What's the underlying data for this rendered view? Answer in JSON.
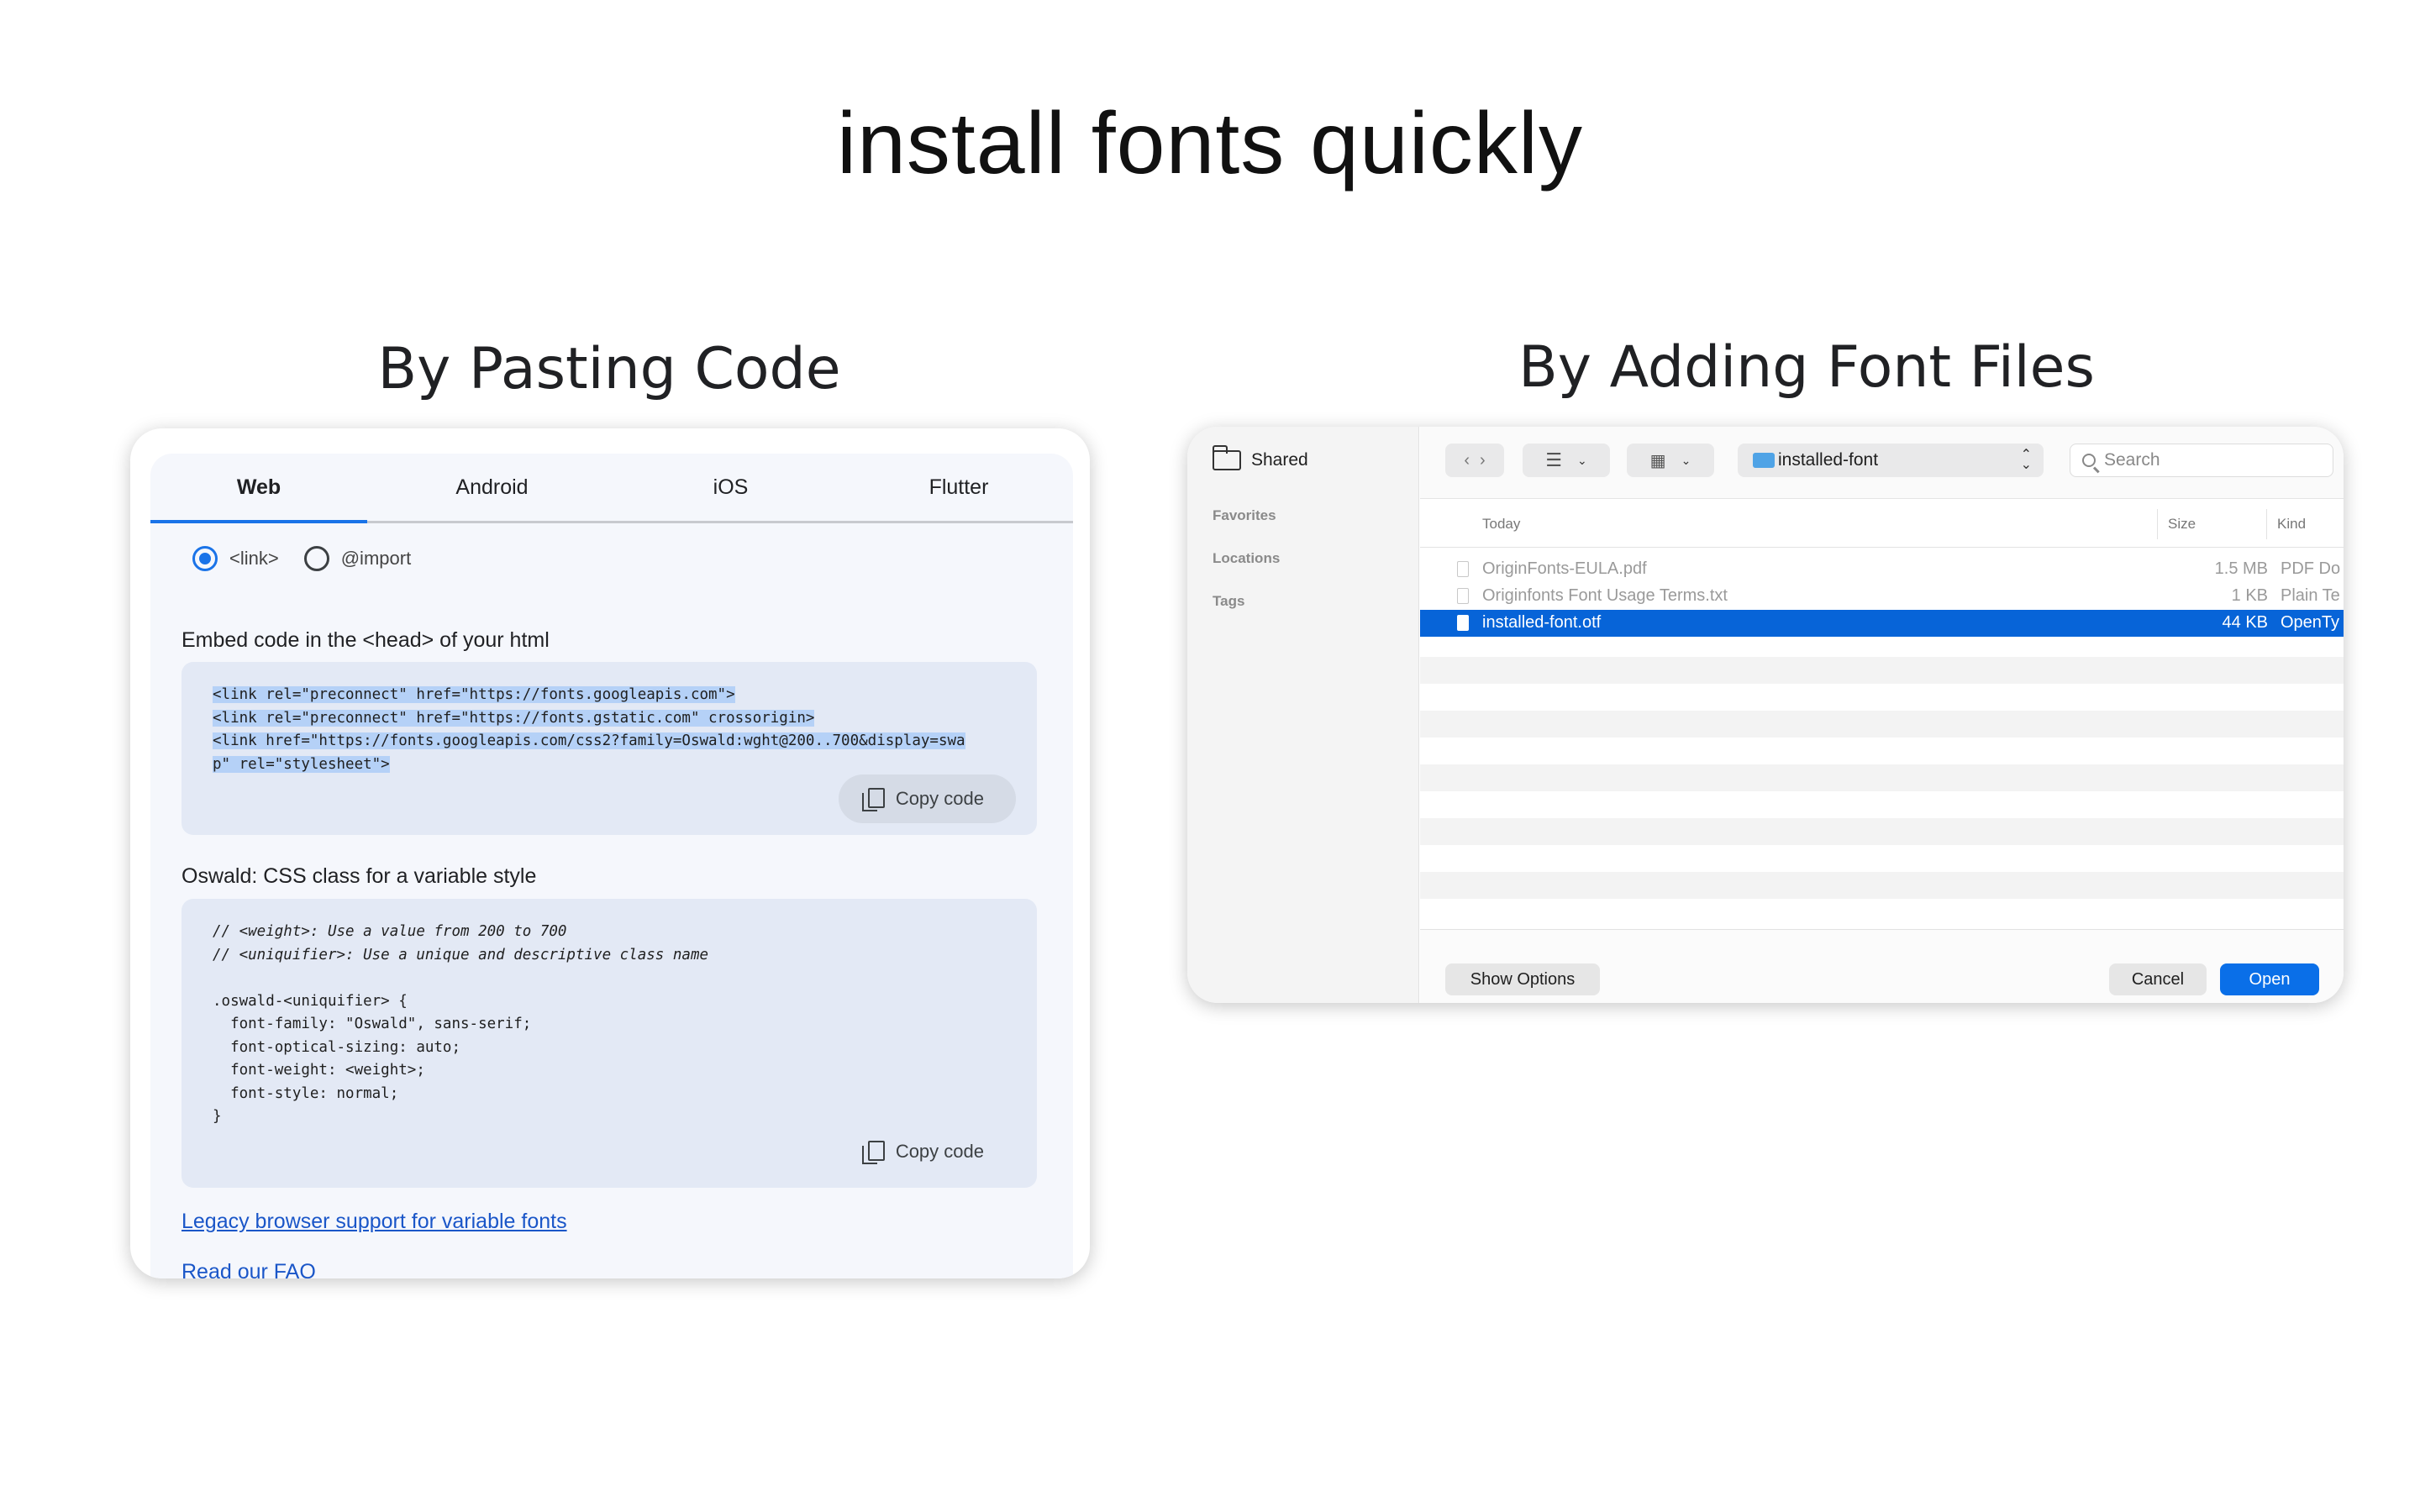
{
  "main_title": "install fonts quickly",
  "left_section_title": "By Pasting Code",
  "right_section_title": "By Adding Font Files",
  "google_fonts": {
    "tabs": [
      {
        "label": "Web",
        "active": true
      },
      {
        "label": "Android",
        "active": false
      },
      {
        "label": "iOS",
        "active": false
      },
      {
        "label": "Flutter",
        "active": false
      }
    ],
    "radio_link_label": "<link>",
    "radio_import_label": "@import",
    "selected_radio": "<link>",
    "embed_heading": "Embed code in the <head> of your html",
    "embed_code_lines": [
      "<link rel=\"preconnect\" href=\"https://fonts.googleapis.com\">",
      "<link rel=\"preconnect\" href=\"https://fonts.gstatic.com\" crossorigin>",
      "<link href=\"https://fonts.googleapis.com/css2?family=Oswald:wght@200..700&display=swa",
      "p\" rel=\"stylesheet\">"
    ],
    "copy_label": "Copy code",
    "class_heading": "Oswald: CSS class for a variable style",
    "class_code_lines": [
      "// <weight>: Use a value from 200 to 700",
      "// <uniquifier>: Use a unique and descriptive class name",
      "",
      ".oswald-<uniquifier> {",
      "  font-family: \"Oswald\", sans-serif;",
      "  font-optical-sizing: auto;",
      "  font-weight: <weight>;",
      "  font-style: normal;",
      "}"
    ],
    "legacy_link": "Legacy browser support for variable fonts",
    "faq_link": "Read our FAQ",
    "accent_color": "#1a73e8"
  },
  "file_dialog": {
    "sidebar": {
      "shared_label": "Shared",
      "favorites_label": "Favorites",
      "locations_label": "Locations",
      "tags_label": "Tags"
    },
    "location_label": "installed-font",
    "search_placeholder": "Search",
    "columns": {
      "name": "Today",
      "size": "Size",
      "kind": "Kind"
    },
    "files": [
      {
        "name": "OriginFonts-EULA.pdf",
        "size": "1.5 MB",
        "kind": "PDF Do",
        "selected": false
      },
      {
        "name": "Originfonts Font Usage Terms.txt",
        "size": "1 KB",
        "kind": "Plain Te",
        "selected": false
      },
      {
        "name": "installed-font.otf",
        "size": "44 KB",
        "kind": "OpenTy",
        "selected": true
      }
    ],
    "show_options_label": "Show Options",
    "cancel_label": "Cancel",
    "open_label": "Open",
    "selection_color": "#0764d8"
  }
}
